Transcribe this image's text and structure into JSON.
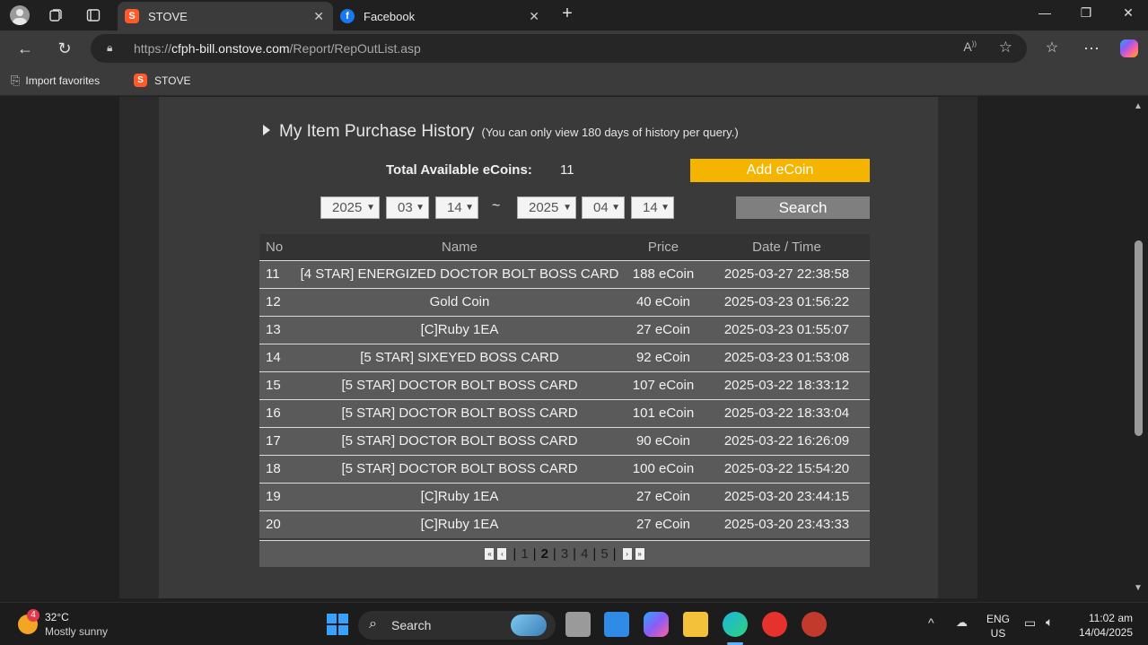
{
  "browser": {
    "tabs": [
      {
        "title": "STOVE",
        "active": true
      },
      {
        "title": "Facebook",
        "active": false
      }
    ],
    "url_prefix": "https://",
    "url_host": "cfph-bill.onstove.com",
    "url_path": "/Report/RepOutList.asp",
    "favorites": [
      "Import favorites",
      "STOVE"
    ]
  },
  "page": {
    "title": "My Item Purchase History",
    "note": "(You can only view 180 days of history per query.)",
    "coins_label": "Total Available eCoins:",
    "coins_value": "11",
    "add_button": "Add eCoin",
    "from": {
      "year": "2025",
      "month": "03",
      "day": "14"
    },
    "tilde": "~",
    "to": {
      "year": "2025",
      "month": "04",
      "day": "14"
    },
    "search_button": "Search",
    "columns": [
      "No",
      "Name",
      "Price",
      "Date / Time"
    ],
    "rows": [
      {
        "no": "11",
        "name": "[4 STAR] ENERGIZED DOCTOR BOLT BOSS CARD",
        "price": "188 eCoin",
        "date": "2025-03-27 22:38:58"
      },
      {
        "no": "12",
        "name": "Gold Coin",
        "price": "40 eCoin",
        "date": "2025-03-23 01:56:22"
      },
      {
        "no": "13",
        "name": "[C]Ruby 1EA",
        "price": "27 eCoin",
        "date": "2025-03-23 01:55:07"
      },
      {
        "no": "14",
        "name": "[5 STAR] SIXEYED BOSS CARD",
        "price": "92 eCoin",
        "date": "2025-03-23 01:53:08"
      },
      {
        "no": "15",
        "name": "[5 STAR] DOCTOR BOLT BOSS CARD",
        "price": "107 eCoin",
        "date": "2025-03-22 18:33:12"
      },
      {
        "no": "16",
        "name": "[5 STAR] DOCTOR BOLT BOSS CARD",
        "price": "101 eCoin",
        "date": "2025-03-22 18:33:04"
      },
      {
        "no": "17",
        "name": "[5 STAR] DOCTOR BOLT BOSS CARD",
        "price": "90 eCoin",
        "date": "2025-03-22 16:26:09"
      },
      {
        "no": "18",
        "name": "[5 STAR] DOCTOR BOLT BOSS CARD",
        "price": "100 eCoin",
        "date": "2025-03-22 15:54:20"
      },
      {
        "no": "19",
        "name": "[C]Ruby 1EA",
        "price": "27 eCoin",
        "date": "2025-03-20 23:44:15"
      },
      {
        "no": "20",
        "name": "[C]Ruby 1EA",
        "price": "27 eCoin",
        "date": "2025-03-20 23:43:33"
      }
    ],
    "pages": [
      "1",
      "2",
      "3",
      "4",
      "5"
    ],
    "current_page": "2"
  },
  "taskbar": {
    "weather_temp": "32°C",
    "weather_desc": "Mostly sunny",
    "weather_badge": "4",
    "search_label": "Search",
    "lang": "ENG",
    "region": "US",
    "time": "11:02 am",
    "date": "14/04/2025"
  }
}
